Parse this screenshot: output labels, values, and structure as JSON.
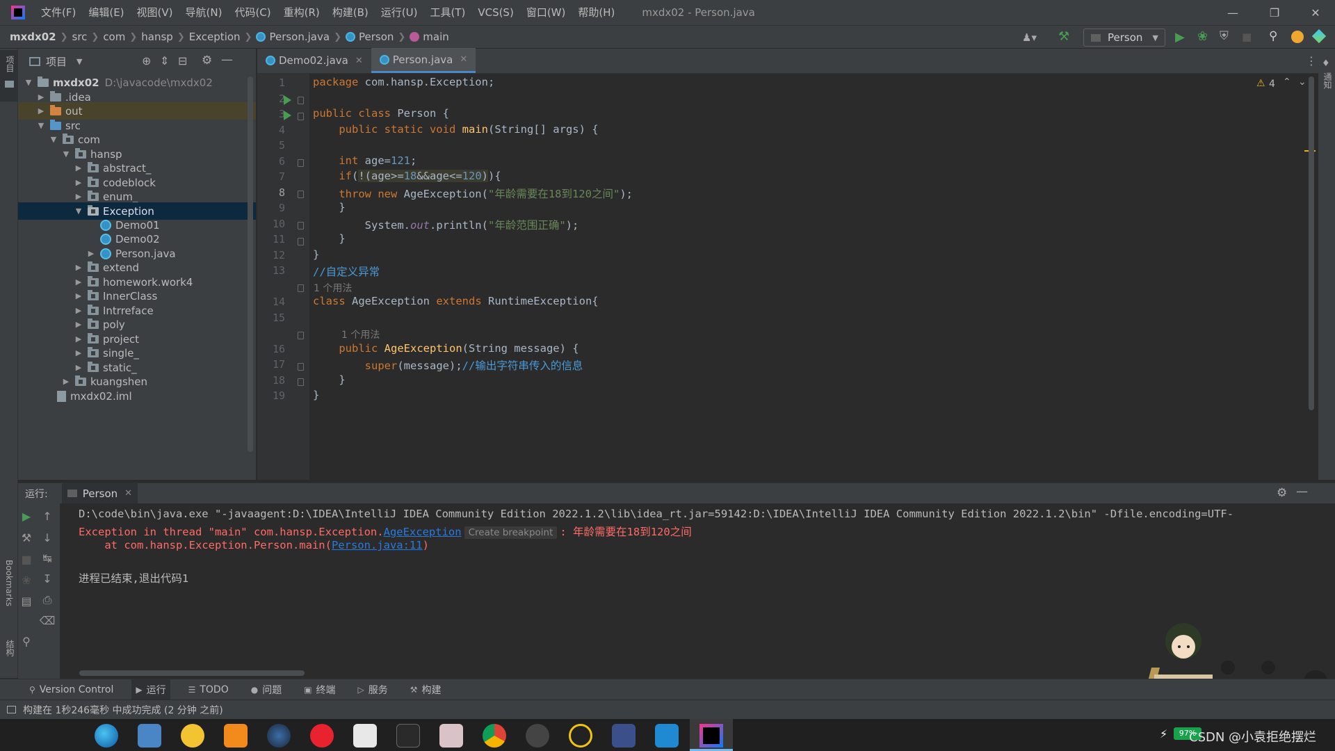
{
  "titlebar": {
    "menus": [
      "文件(F)",
      "编辑(E)",
      "视图(V)",
      "导航(N)",
      "代码(C)",
      "重构(R)",
      "构建(B)",
      "运行(U)",
      "工具(T)",
      "VCS(S)",
      "窗口(W)",
      "帮助(H)"
    ],
    "window_title": "mxdx02 - Person.java"
  },
  "navbar": {
    "crumbs": [
      "mxdx02",
      "src",
      "com",
      "hansp",
      "Exception",
      "Person.java",
      "Person",
      "main"
    ],
    "run_config": "Person"
  },
  "left_strip": {
    "project_label": "项目",
    "bookmarks_label": "Bookmarks",
    "structure_label": "结构"
  },
  "right_strip": {
    "notifications_label": "通知"
  },
  "project_panel": {
    "title": "项目",
    "root": {
      "name": "mxdx02",
      "path": "D:\\javacode\\mxdx02"
    },
    "items": [
      ".idea",
      "out",
      "src",
      "com",
      "hansp",
      "abstract_",
      "codeblock",
      "enum_",
      "Exception",
      "Demo01",
      "Demo02",
      "Person.java",
      "extend",
      "homework.work4",
      "InnerClass",
      "Intrreface",
      "poly",
      "project",
      "single_",
      "static_",
      "kuangshen",
      "mxdx02.iml"
    ]
  },
  "editor": {
    "tabs": [
      "Demo02.java",
      "Person.java"
    ],
    "warning_count": "4",
    "usage_hint_1": "1 个用法",
    "usage_hint_2": "1 个用法",
    "line_numbers": [
      "1",
      "2",
      "3",
      "4",
      "5",
      "6",
      "7",
      "8",
      "9",
      "10",
      "11",
      "12",
      "13",
      "14",
      "15",
      "16",
      "17",
      "18",
      "19"
    ]
  },
  "run_panel": {
    "label": "运行:",
    "tab": "Person",
    "lines": {
      "cmd": "D:\\code\\bin\\java.exe \"-javaagent:D:\\IDEA\\IntelliJ IDEA Community Edition 2022.1.2\\lib\\idea_rt.jar=59142:D:\\IDEA\\IntelliJ IDEA Community Edition 2022.1.2\\bin\" -Dfile.encoding=UTF-",
      "exc_prefix": "Exception in thread \"main\" com.hansp.Exception.",
      "exc_link": "AgeException",
      "breakpoint_hint": "Create breakpoint",
      "exc_msg": ": 年龄需要在18到120之间",
      "at_prefix": "    at com.hansp.Exception.Person.main(",
      "at_link": "Person.java:11",
      "at_suffix": ")",
      "exit": "进程已结束,退出代码1"
    }
  },
  "bottom_tabs": [
    "Version Control",
    "运行",
    "TODO",
    "问题",
    "终端",
    "服务",
    "构建"
  ],
  "statusbar": {
    "message": "构建在 1秒246毫秒 中成功完成 (2 分钟 之前)"
  },
  "taskbar": {
    "battery": "97%",
    "watermark": "CSDN @小袁拒绝摆烂"
  },
  "colors": {
    "keyword": "#cc7832",
    "string": "#6a8759",
    "number": "#6897bb",
    "function": "#ffc66d",
    "comment": "#629755",
    "error": "#ff6b68",
    "link": "#287bde"
  }
}
